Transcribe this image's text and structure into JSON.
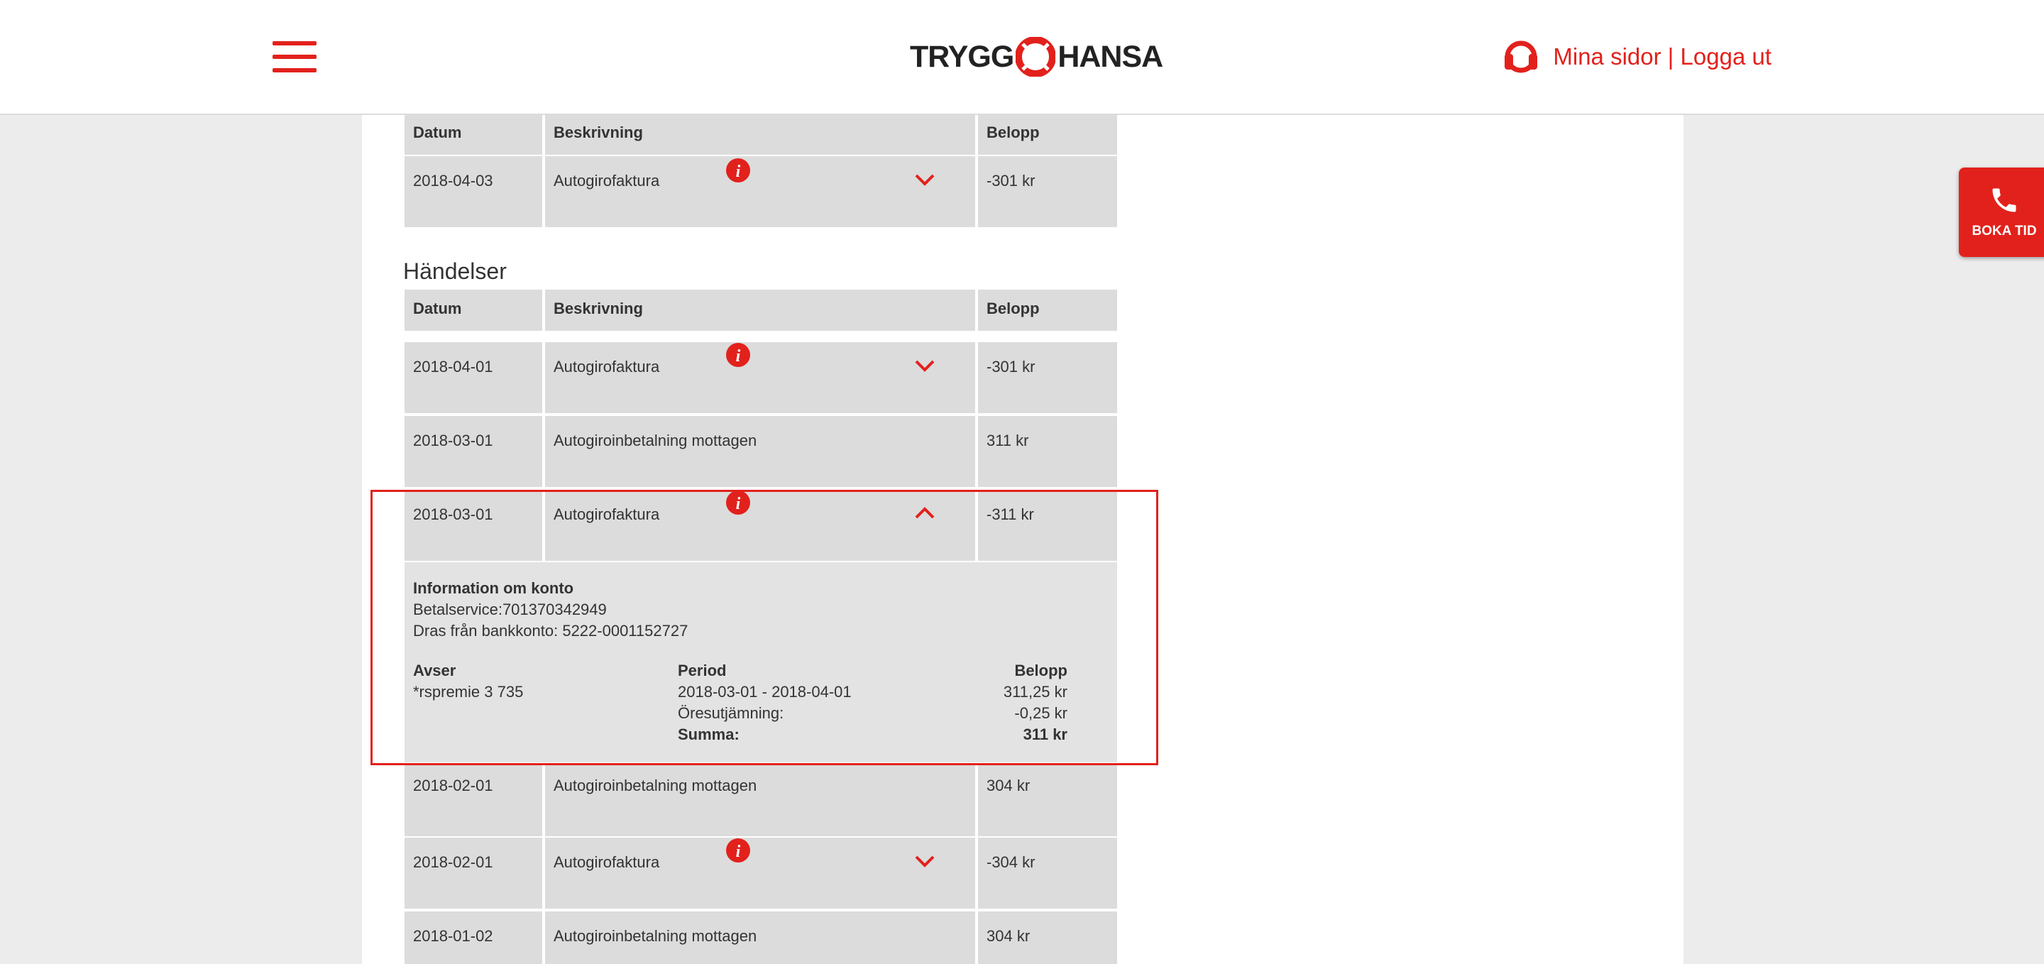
{
  "header": {
    "brand_left": "TRYGG",
    "brand_right": "HANSA",
    "mina_sidor": "Mina sidor",
    "separator": " | ",
    "logga_ut": "Logga ut"
  },
  "boka_tid": {
    "label": "BOKA TID"
  },
  "table_columns": {
    "datum": "Datum",
    "beskrivning": "Beskrivning",
    "belopp": "Belopp"
  },
  "top_table": {
    "rows": [
      {
        "datum": "2018-04-03",
        "beskrivning": "Autogirofaktura",
        "belopp": "-301 kr"
      }
    ]
  },
  "handelser": {
    "title": "Händelser",
    "rows": [
      {
        "datum": "2018-04-01",
        "beskrivning": "Autogirofaktura",
        "belopp": "-301 kr"
      },
      {
        "datum": "2018-03-01",
        "beskrivning": "Autogiroinbetalning mottagen",
        "belopp": "311 kr"
      },
      {
        "datum": "2018-03-01",
        "beskrivning": "Autogirofaktura",
        "belopp": "-311 kr"
      },
      {
        "datum": "2018-02-01",
        "beskrivning": "Autogiroinbetalning mottagen",
        "belopp": "304 kr"
      },
      {
        "datum": "2018-02-01",
        "beskrivning": "Autogirofaktura",
        "belopp": "-304 kr"
      },
      {
        "datum": "2018-01-02",
        "beskrivning": "Autogiroinbetalning mottagen",
        "belopp": "304 kr"
      }
    ]
  },
  "detail": {
    "heading": "Information om konto",
    "betalservice": "Betalservice:701370342949",
    "bankkonto": "Dras från bankkonto: 5222-0001152727",
    "avser_label": "Avser",
    "avser_value": "*rspremie 3 735",
    "period_label": "Period",
    "period_value": "2018-03-01 - 2018-04-01",
    "oresutjamning_label": "Öresutjämning:",
    "summa_label": "Summa:",
    "belopp_label": "Belopp",
    "belopp_value": "311,25 kr",
    "oresutjamning_value": "-0,25 kr",
    "summa_value": "311 kr"
  },
  "colors": {
    "accent": "#e2211c",
    "cell_bg": "#dcdcdc",
    "detail_bg": "#e3e3e3"
  }
}
